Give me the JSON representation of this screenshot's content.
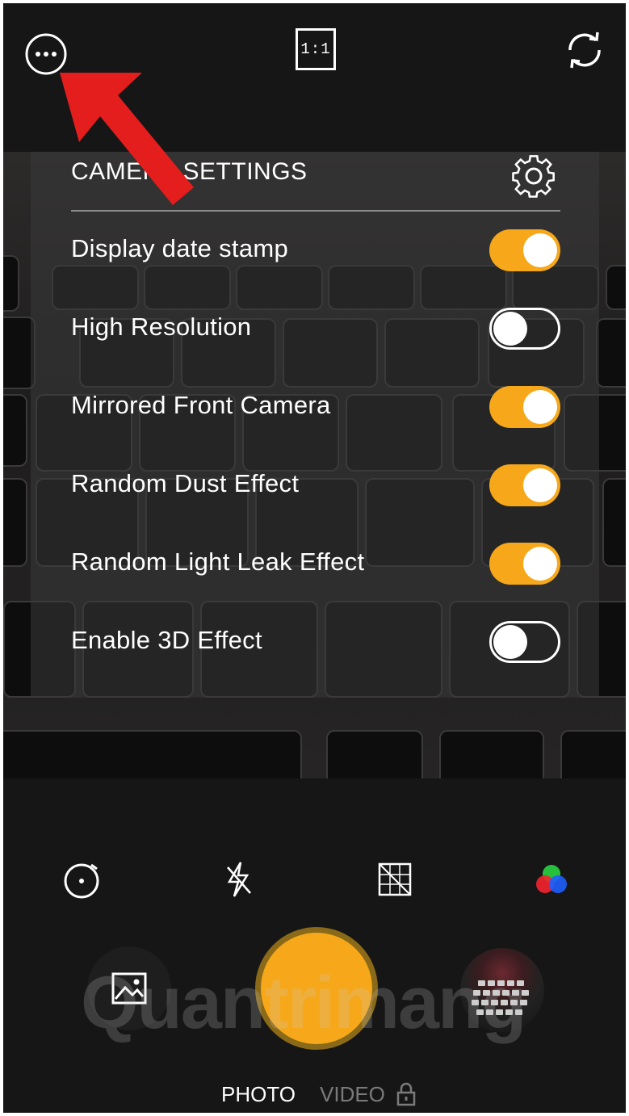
{
  "top_bar": {
    "more_icon": "more-circle-icon",
    "ratio_label": "1:1",
    "flip_icon": "flip-camera-icon"
  },
  "settings": {
    "title": "CAMERA SETTINGS",
    "gear_icon": "gear-icon",
    "items": [
      {
        "label": "Display date stamp",
        "enabled": true
      },
      {
        "label": "High Resolution",
        "enabled": false
      },
      {
        "label": "Mirrored Front Camera",
        "enabled": true
      },
      {
        "label": "Random Dust Effect",
        "enabled": true
      },
      {
        "label": "Random Light Leak Effect",
        "enabled": true
      },
      {
        "label": "Enable 3D Effect",
        "enabled": false
      }
    ]
  },
  "tools": {
    "timer_icon": "timer-icon",
    "flash_icon": "flash-off-icon",
    "grid_icon": "grid-icon",
    "color_icon": "color-filter-icon"
  },
  "bottom": {
    "gallery_icon": "gallery-icon",
    "modes": [
      "PHOTO",
      "VIDEO"
    ],
    "active_mode": "PHOTO",
    "video_locked": true,
    "watermark": "Quantrimang"
  },
  "colors": {
    "accent": "#f6a81a",
    "arrow": "#e41d1d"
  }
}
